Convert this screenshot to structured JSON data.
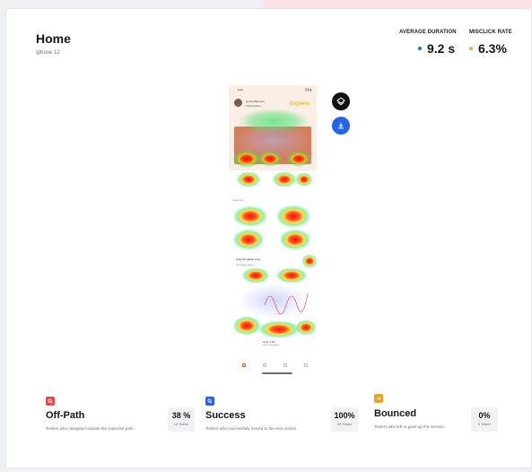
{
  "page": {
    "title": "Home",
    "device": "Iphone 12"
  },
  "metrics": [
    {
      "label": "AVERAGE DURATION",
      "value": "9.2 s",
      "dot_color": "#2563eb"
    },
    {
      "label": "MISCLICK RATE",
      "value": "6.3%",
      "dot_color": "#f59e4b"
    }
  ],
  "phone": {
    "time": "9:41",
    "signal": "▎▎▮",
    "user_name": "Good Afternoon",
    "user_sub": "Olivia Adams",
    "explore": "Explore",
    "section_title": "Discover",
    "card_title": "Daily Breakfast Grat...",
    "card_sub": "Complete Story",
    "footer_title": "Hello 1 B2",
    "footer_sub": "What a beautiful day"
  },
  "actions": {
    "layers_icon": "layers-icon",
    "download_icon": "download-icon"
  },
  "stats": [
    {
      "title": "Off-Path",
      "description": "Testers who navigated outside the expected path.",
      "percent": "38 %",
      "count": "10 Tester",
      "color": "#e5484d",
      "icon": "off-path-icon"
    },
    {
      "title": "Success",
      "description": "Testers who successfully moved to the next screen.",
      "percent": "100%",
      "count": "26 Tester",
      "color": "#2563eb",
      "icon": "success-icon"
    },
    {
      "title": "Bounced",
      "description": "Testers who left or gave up the mission.",
      "percent": "0%",
      "count": "0 Tester",
      "color": "#f0a020",
      "icon": "bounced-icon"
    }
  ]
}
